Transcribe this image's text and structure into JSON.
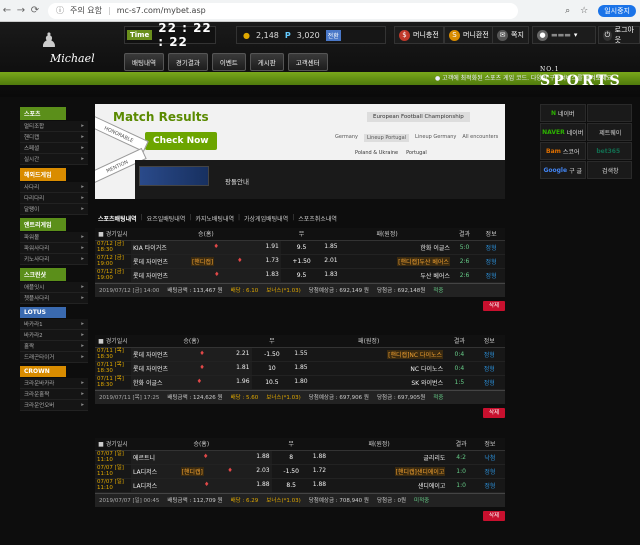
{
  "browser": {
    "security": "주의 요함",
    "url": "mc-s7.com/mybet.asp",
    "pause": "일시중지"
  },
  "site": {
    "logo": "Michael",
    "sports_no": "NO.1",
    "sports": "SPORTS"
  },
  "top": {
    "time_label": "Time",
    "time": "22 : 22 : 22",
    "money": "2,148",
    "point": "3,020",
    "point_label": "P",
    "conv": "전환",
    "btn_charge": "머니충전",
    "btn_exchange": "머니환전",
    "btn_msg": "쪽지",
    "btn_logout": "로그아웃"
  },
  "menu": [
    "배팅내역",
    "경기결과",
    "이벤트",
    "게시판",
    "고객센터"
  ],
  "notice": "● 고객에 최적화된 스포츠 게임 코드. 다양한 구독서비스를 즐겨보세요",
  "sidebar": [
    {
      "cat": "스포츠",
      "color": "#5b8f1a",
      "items": [
        "멀티조합",
        "핸디캡",
        "스페셜",
        "실시간"
      ]
    },
    {
      "cat": "해외드게임",
      "color": "#d98c00",
      "items": [
        "사다리",
        "다리다리",
        "달팽이"
      ]
    },
    {
      "cat": "엔트리게임",
      "color": "#5b8f1a",
      "items": [
        "파워볼",
        "파워사다리",
        "키노사다리"
      ]
    },
    {
      "cat": "스크린샷",
      "color": "#5b8f1a",
      "items": [
        "애플잇시",
        "쳇플사다리"
      ]
    },
    {
      "cat": "LOTUS",
      "color": "#3a6ab0",
      "items": [
        "바카라1",
        "바카라2",
        "홀짝",
        "드래곤타이거"
      ]
    },
    {
      "cat": "CROWN",
      "color": "#d98c00",
      "items": [
        "크라운바카라",
        "크라운홀짝",
        "크라운언오버"
      ]
    }
  ],
  "banner": {
    "title": "Match Results",
    "check": "Check Now",
    "honorable": "HONORABLE",
    "mention": "MENTION",
    "championship": "European Football Championship",
    "tabs": [
      "Germany",
      "Lineup Portugal",
      "Lineup Germany",
      "All encounters"
    ],
    "teams": [
      "Poland & Ukraine",
      "Portugal"
    ],
    "guide": "팡돌안내"
  },
  "bettabs": [
    "스포츠배팅내역",
    "요즈일배팅내역",
    "카지노배팅내역",
    "가상게임배팅내역",
    "스포츠취소내역"
  ],
  "cols": {
    "date": "경기일시",
    "home": "승(홈)",
    "mid": "무",
    "away": "패(원정)",
    "result": "결과",
    "status": "정보"
  },
  "blocks": [
    {
      "rows": [
        {
          "date": "07/12 [금] 18:30",
          "home": "KIA 타이거즈",
          "hodd": "1.91",
          "mid": "9.5",
          "away": "",
          "aodd": "1.85",
          "aname": "한화 이글스",
          "res": "5:0",
          "st": "정형"
        },
        {
          "date": "07/12 [금] 19:00",
          "home": "롯데 자이언츠",
          "htag": "[핸디캡]",
          "hodd": "1.73",
          "mid": "+1.50",
          "away": "[핸디캡]두산 베어스",
          "aodd": "2.01",
          "aname": "",
          "res": "2:6",
          "st": "정형"
        },
        {
          "date": "07/12 [금] 19:00",
          "home": "롯데 자이언츠",
          "hodd": "1.83",
          "mid": "9.5",
          "away": "",
          "aodd": "1.83",
          "aname": "두산 베어스",
          "res": "2:6",
          "st": "정형"
        }
      ],
      "sum": {
        "time": "2019/07/12 [금] 14:00",
        "betamt": "배팅금액 : 113,467 원",
        "rate": "배당 : 6.10",
        "bonus": "보너스(*1.03)",
        "exp": "당첨예상금 : 692,149 원",
        "win": "당첨금 : 692,148원",
        "status": "적중"
      },
      "del": "삭제"
    },
    {
      "rows": [
        {
          "date": "07/11 [목] 18:30",
          "home": "롯데 자이언츠",
          "hodd": "2.21",
          "mid": "-1.50",
          "away": "[핸디캡]NC 다이노스",
          "aodd": "1.55",
          "aname": "",
          "res": "0:4",
          "st": "정형"
        },
        {
          "date": "07/11 [목] 18:30",
          "home": "롯데 자이언츠",
          "hodd": "1.81",
          "mid": "10",
          "away": "",
          "aodd": "1.85",
          "aname": "NC 다이노스",
          "res": "0:4",
          "st": "정형"
        },
        {
          "date": "07/11 [목] 18:30",
          "home": "한화 이글스",
          "hodd": "1.96",
          "mid": "10.5",
          "away": "",
          "aodd": "1.80",
          "aname": "SK 와이번스",
          "res": "1:5",
          "st": "정형"
        }
      ],
      "sum": {
        "time": "2019/07/11 [목] 17:25",
        "betamt": "배팅금액 : 124,626 원",
        "rate": "배당 : 5.60",
        "bonus": "보너스(*1.03)",
        "exp": "당첨예상금 : 697,906 원",
        "win": "당첨금 : 697,905원",
        "status": "적중"
      },
      "del": "삭제"
    },
    {
      "rows": [
        {
          "date": "07/07 [일] 11:10",
          "home": "에르트니",
          "hodd": "1.88",
          "mid": "8",
          "away": "",
          "aodd": "1.88",
          "aname": "글리리도",
          "res": "4:2",
          "st": "낙첨"
        },
        {
          "date": "07/07 [일] 11:10",
          "home": "LA디저스",
          "htag": "[핸디캡]",
          "hodd": "2.03",
          "mid": "-1.50",
          "away": "[핸디캡]샌디에이고",
          "aodd": "1.72",
          "aname": "",
          "res": "1:0",
          "st": "정형"
        },
        {
          "date": "07/07 [일] 11:10",
          "home": "LA디저스",
          "hodd": "1.88",
          "mid": "8.5",
          "away": "",
          "aodd": "1.88",
          "aname": "샌디에이고",
          "res": "1:0",
          "st": "정형"
        }
      ],
      "sum": {
        "time": "2019/07/07 [일] 00:45",
        "betamt": "배팅금액 : 112,709 원",
        "rate": "배당 : 6.29",
        "bonus": "보너스(*1.03)",
        "exp": "당첨예상금 : 708,940 원",
        "win": "당첨금 : 0원",
        "status": "미적중"
      },
      "del": "삭제"
    }
  ],
  "right": [
    {
      "l": "N",
      "t": "네이버",
      "c": "#2db400"
    },
    {
      "l": "",
      "t": "",
      "c": "#1a1a1a"
    },
    {
      "l": "NAVER",
      "t": "네이버",
      "c": "#2db400"
    },
    {
      "l": "",
      "t": "제트웨이",
      "c": "#333"
    },
    {
      "l": "Bam",
      "t": "스코어",
      "c": "#e07000"
    },
    {
      "l": "bet365",
      "t": "",
      "c": "#126e51"
    },
    {
      "l": "Google",
      "t": "구 글",
      "c": "#4285f4"
    },
    {
      "l": "",
      "t": "검색창",
      "c": "#333"
    }
  ]
}
